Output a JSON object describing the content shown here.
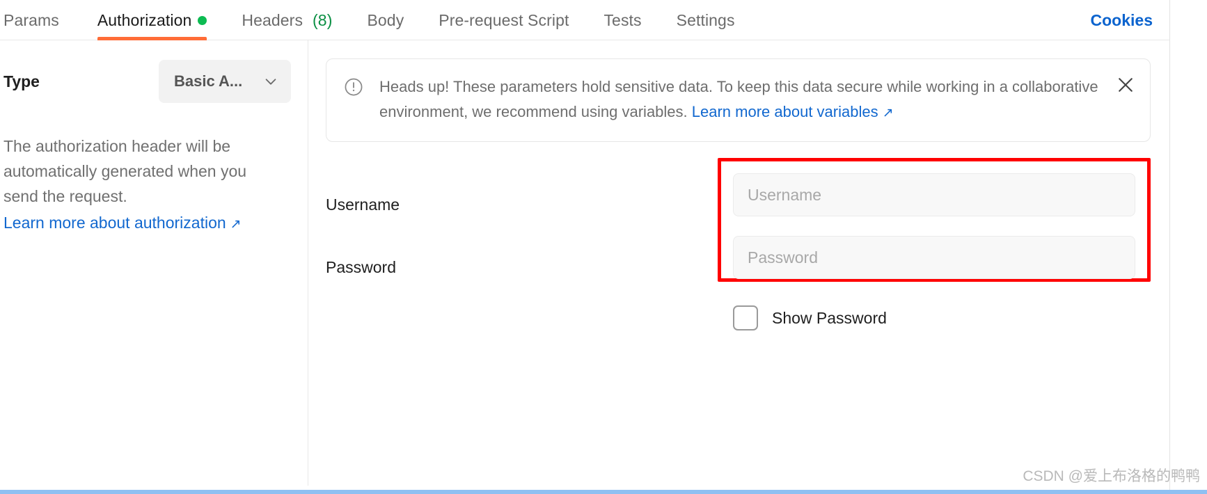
{
  "tabs": [
    {
      "label": "Params",
      "active": false,
      "dot": false,
      "count": null
    },
    {
      "label": "Authorization",
      "active": true,
      "dot": true,
      "count": null
    },
    {
      "label": "Headers",
      "active": false,
      "dot": false,
      "count": "(8)"
    },
    {
      "label": "Body",
      "active": false,
      "dot": false,
      "count": null
    },
    {
      "label": "Pre-request Script",
      "active": false,
      "dot": false,
      "count": null
    },
    {
      "label": "Tests",
      "active": false,
      "dot": false,
      "count": null
    },
    {
      "label": "Settings",
      "active": false,
      "dot": false,
      "count": null
    }
  ],
  "header": {
    "cookies_label": "Cookies"
  },
  "sidebar": {
    "type_label": "Type",
    "type_value": "Basic A...",
    "description": "The authorization header will be automatically generated when you send the request.",
    "learn_more_label": "Learn more about authorization",
    "learn_more_arrow": "↗"
  },
  "banner": {
    "icon": "info-circle-icon",
    "text_before_link": "Heads up! These parameters hold sensitive data. To keep this data secure while working in a collaborative environment, we recommend using variables. ",
    "link_label": "Learn more about variables",
    "link_arrow": "↗",
    "close_icon": "close-icon"
  },
  "form": {
    "username_label": "Username",
    "password_label": "Password",
    "username_value": "",
    "username_placeholder": "Username",
    "password_value": "",
    "password_placeholder": "Password",
    "show_password_label": "Show Password",
    "show_password_checked": false
  },
  "footer": {
    "watermark": "CSDN @爱上布洛格的鸭鸭"
  },
  "colors": {
    "accent_orange": "#ff6c37",
    "status_green": "#0cbb52",
    "count_green": "#0a8f43",
    "link_blue": "#1268cf",
    "cookies_blue": "#0b63ce",
    "highlight_red": "#ff0000",
    "bottom_rule_blue": "#8fc0f2"
  }
}
